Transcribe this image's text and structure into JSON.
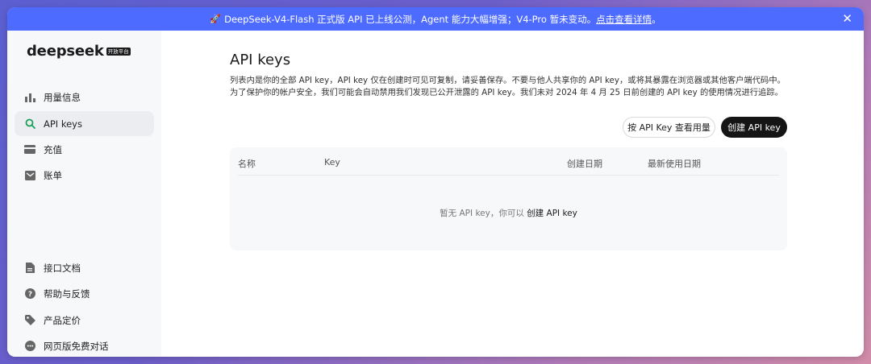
{
  "banner": {
    "icon": "rocket-icon",
    "text": "DeepSeek-V4-Flash 正式版 API 已上线公测，Agent 能力大幅增强；V4-Pro 暂未变动。",
    "link": "点击查看详情",
    "tail": "。",
    "color": "#4d6bfe"
  },
  "logo": {
    "text": "deepseek",
    "badge": "开放平台"
  },
  "sidebar": {
    "items": [
      {
        "label": "用量信息",
        "icon": "bar-chart-icon"
      },
      {
        "label": "API keys",
        "icon": "search-icon"
      },
      {
        "label": "充值",
        "icon": "credit-card-icon"
      },
      {
        "label": "账单",
        "icon": "inbox-icon"
      }
    ],
    "footer": [
      {
        "label": "接口文档",
        "icon": "document-icon"
      },
      {
        "label": "帮助与反馈",
        "icon": "help-icon"
      },
      {
        "label": "产品定价",
        "icon": "tag-icon"
      },
      {
        "label": "网页版免费对话",
        "icon": "chat-icon"
      }
    ]
  },
  "main": {
    "title": "API keys",
    "desc_line1": "列表内是你的全部 API key，API key 仅在创建时可见可复制，请妥善保存。不要与他人共享你的 API key，或将其暴露在浏览器或其他客户端代码中。",
    "desc_line2": "为了保护你的帐户安全，我们可能会自动禁用我们发现已公开泄露的 API key。我们未对 2024 年 4 月 25 日前创建的 API key 的使用情况进行追踪。",
    "usage_button": "按 API Key 查看用量",
    "create_button": "创建 API key",
    "table": {
      "columns": [
        "名称",
        "Key",
        "创建日期",
        "最新使用日期"
      ],
      "empty_text": "暂无 API key，你可以 ",
      "empty_link": "创建 API key"
    }
  }
}
